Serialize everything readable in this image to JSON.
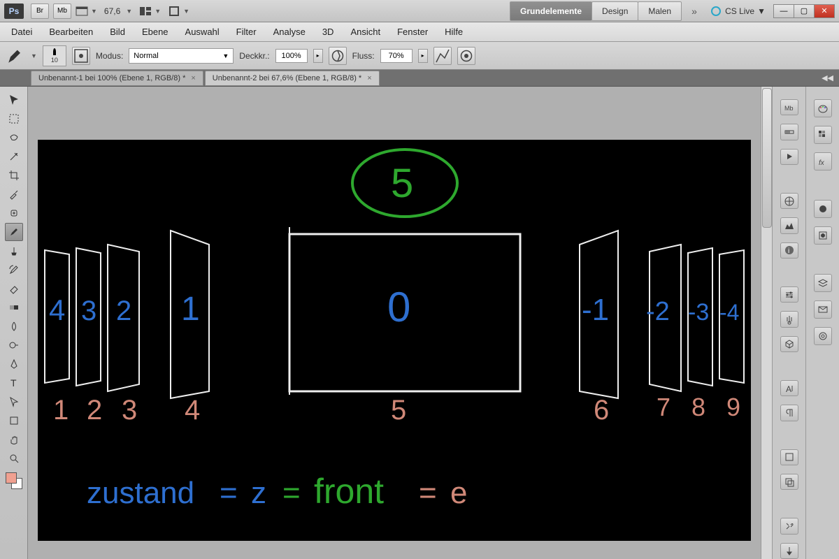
{
  "app": {
    "logo": "Ps",
    "launcher_br": "Br",
    "launcher_mb": "Mb",
    "zoom": "67,6",
    "cslive": "CS Live"
  },
  "workspace": {
    "tabs": [
      "Grundelemente",
      "Design",
      "Malen"
    ],
    "active": 0,
    "more_glyph": "»"
  },
  "menu": [
    "Datei",
    "Bearbeiten",
    "Bild",
    "Ebene",
    "Auswahl",
    "Filter",
    "Analyse",
    "3D",
    "Ansicht",
    "Fenster",
    "Hilfe"
  ],
  "options": {
    "brush_size": "10",
    "modus_label": "Modus:",
    "modus_value": "Normal",
    "deckkr_label": "Deckkr.:",
    "deckkr_value": "100%",
    "fluss_label": "Fluss:",
    "fluss_value": "70%"
  },
  "documents": [
    {
      "title": "Unbenannt-1 bei 100% (Ebene 1, RGB/8) *",
      "active": false
    },
    {
      "title": "Unbenannt-2 bei 67,6% (Ebene 1, RGB/8) *",
      "active": true
    }
  ],
  "tools_left": [
    "move",
    "marquee",
    "lasso",
    "wand",
    "crop",
    "eyedropper",
    "healing",
    "brush",
    "stamp",
    "history",
    "eraser",
    "gradient",
    "blur",
    "dodge",
    "pen",
    "type",
    "path",
    "shape",
    "hand",
    "zoom"
  ],
  "canvas_content": {
    "circled_number": "5",
    "center_number": "0",
    "left_plane_numbers": [
      "4",
      "3",
      "2",
      "1"
    ],
    "right_plane_numbers": [
      "-1",
      "-2",
      "-3",
      "-4"
    ],
    "bottom_indices": [
      "1",
      "2",
      "3",
      "4",
      "5",
      "6",
      "7",
      "8",
      "9"
    ],
    "equation_parts": {
      "a": "zustand",
      "eq1": "=",
      "b": "z",
      "eq2": "=",
      "c": "front",
      "eq3": "=",
      "d": "e"
    }
  },
  "panel_icons_col1": [
    "mb",
    "ruler",
    "play",
    "compass",
    "histogram",
    "info",
    "sliders",
    "usb",
    "3d",
    "text",
    "paragraph",
    "rect",
    "copy",
    "wrench",
    "anchor"
  ],
  "panel_icons_col2": [
    "palette",
    "grid",
    "fx",
    "stack",
    "lens",
    "layers",
    "transform",
    "globe"
  ]
}
